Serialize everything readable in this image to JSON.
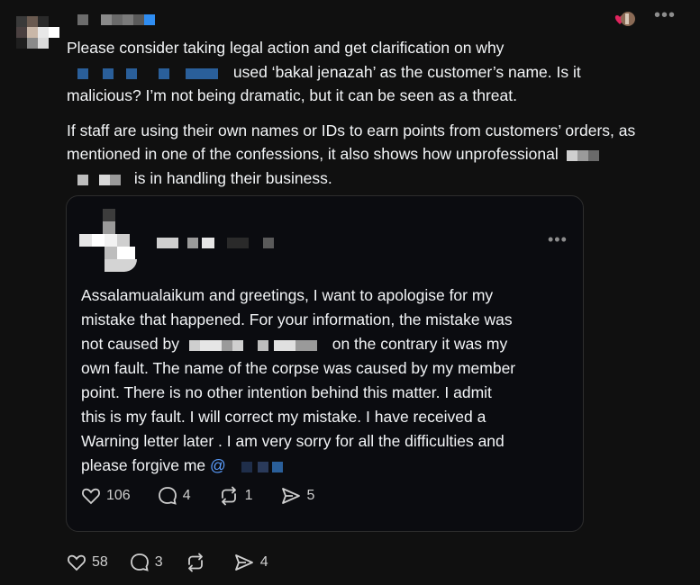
{
  "post": {
    "paragraph1_a": "Please consider taking legal action and get clarification on why",
    "paragraph1_b": "used ‘bakal jenazah’ as the customer’s name. Is it",
    "paragraph1_c": "malicious? I’m not being dramatic, but it can be seen as a threat.",
    "paragraph2_a": "If staff are using their own names or IDs to earn points from customers’ orders, as",
    "paragraph2_b": "mentioned in one of the confessions, it also shows how unprofessional",
    "paragraph2_c": "is in handling their business.",
    "more_label": "•••"
  },
  "quoted": {
    "line1": "Assalamualaikum and greetings, I want to apologise for my",
    "line2": "mistake that happened. For your information, the mistake was",
    "line3_a": "not caused by",
    "line3_b": "on the contrary it was my",
    "line4": "own fault. The name of the corpse was caused by my member",
    "line5": "point. There is no other intention behind this matter. I admit",
    "line6": "this is my fault. I will correct my mistake. I have received a",
    "line7": "Warning letter later . I am very sorry for all the difficulties and",
    "line8_a": "please forgive me",
    "mention_at": "@",
    "more_label": "•••",
    "likes": "106",
    "comments": "4",
    "reposts": "1",
    "shares": "5"
  },
  "outer_actions": {
    "likes": "58",
    "comments": "3",
    "shares": "4"
  },
  "icons": {
    "like": "heart-icon",
    "comment": "comment-icon",
    "repost": "repost-icon",
    "share": "share-icon"
  }
}
